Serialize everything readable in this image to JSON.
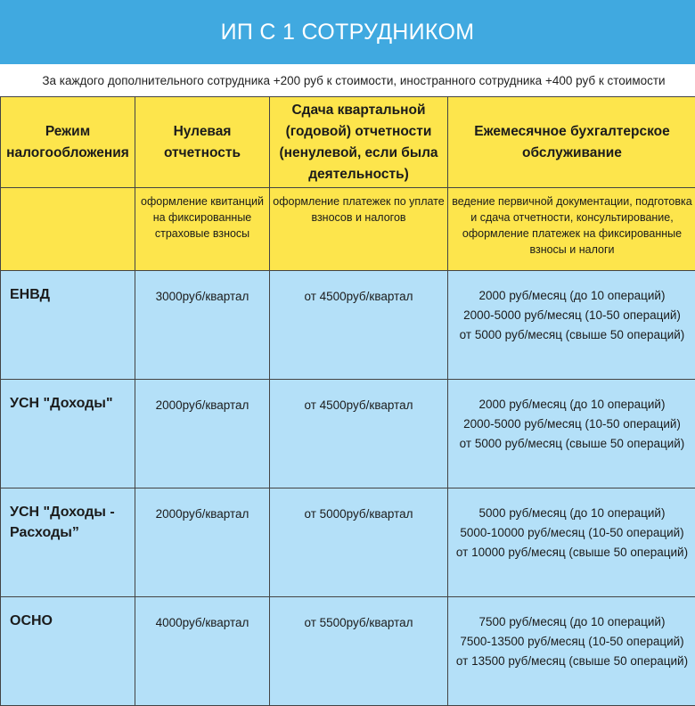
{
  "title": "ИП С 1 СОТРУДНИКОМ",
  "note": "За каждого дополнительного сотрудника +200 руб к стоимости, иностранного сотрудника +400 руб к стоимости",
  "colors": {
    "banner": "#40a9e0",
    "header_bg": "#fde54c",
    "body_bg": "#b4e0f8"
  },
  "columns": [
    {
      "header": "Режим налогообложения",
      "description": ""
    },
    {
      "header": "Нулевая отчетность",
      "description": "оформление квитанций на фиксированные страховые взносы"
    },
    {
      "header": "Сдача квартальной (годовой) отчетности (ненулевой, если была деятельность)",
      "description": "оформление платежек по уплате взносов и налогов"
    },
    {
      "header": "Ежемесячное бухгалтерское обслуживание",
      "description": "ведение первичной документации, подготовка и сдача отчетности, консультирование, оформление платежек на фиксированные взносы и налоги"
    }
  ],
  "rows": [
    {
      "regime": "ЕНВД",
      "zero": "3000руб/квартал",
      "quarterly": "от 4500руб/квартал",
      "monthly": [
        "2000 руб/месяц (до 10 операций)",
        "2000-5000 руб/месяц (10-50 операций)",
        "от 5000 руб/месяц (свыше 50 операций)"
      ]
    },
    {
      "regime": "УСН \"Доходы\"",
      "zero": "2000руб/квартал",
      "quarterly": "от 4500руб/квартал",
      "monthly": [
        "2000 руб/месяц (до 10 операций)",
        "2000-5000 руб/месяц (10-50 операций)",
        "от 5000 руб/месяц (свыше 50 операций)"
      ]
    },
    {
      "regime": "УСН \"Доходы - Расходы”",
      "zero": "2000руб/квартал",
      "quarterly": "от 5000руб/квартал",
      "monthly": [
        "5000 руб/месяц (до 10 операций)",
        "5000-10000 руб/месяц (10-50 операций)",
        "от 10000 руб/месяц (свыше 50 операций)"
      ]
    },
    {
      "regime": "ОСНО",
      "zero": "4000руб/квартал",
      "quarterly": "от 5500руб/квартал",
      "monthly": [
        "7500 руб/месяц (до 10 операций)",
        "7500-13500 руб/месяц (10-50 операций)",
        "от 13500 руб/месяц (свыше 50 операций)"
      ]
    }
  ]
}
